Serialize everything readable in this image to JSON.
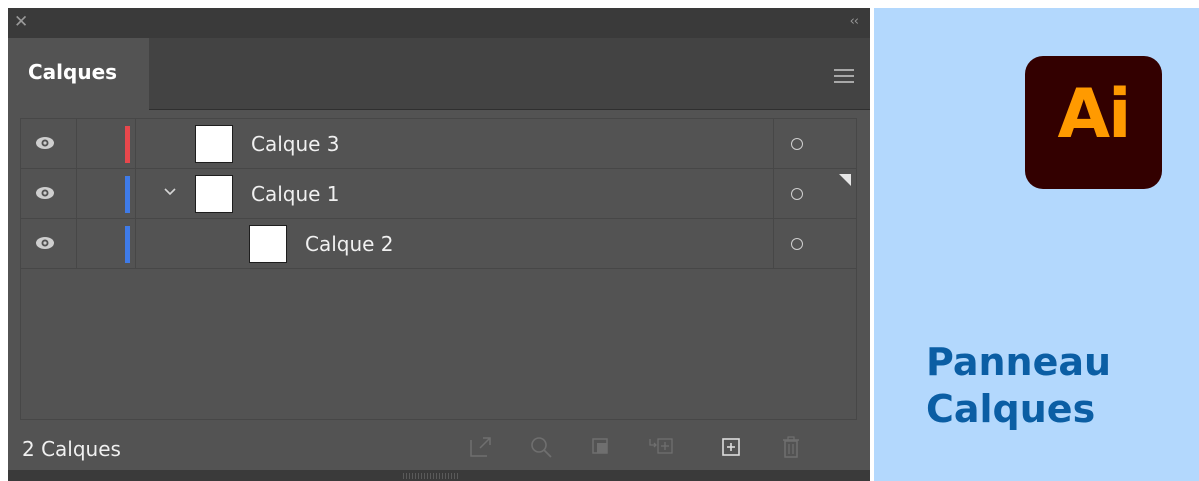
{
  "panel": {
    "tab_label": "Calques",
    "layers": [
      {
        "name": "Calque 3",
        "color": "#e8474c",
        "indent": 0,
        "has_chevron": false
      },
      {
        "name": "Calque 1",
        "color": "#3f7be8",
        "indent": 0,
        "has_chevron": true
      },
      {
        "name": "Calque 2",
        "color": "#3f7be8",
        "indent": 1,
        "has_chevron": false
      }
    ],
    "footer_count": "2 Calques",
    "footer_icons": [
      "export-icon",
      "search-icon",
      "clipping-mask-icon",
      "new-sublayer-icon",
      "new-layer-icon",
      "trash-icon"
    ]
  },
  "promo": {
    "logo_text": "Ai",
    "title_line1": "Panneau",
    "title_line2": "Calques"
  }
}
